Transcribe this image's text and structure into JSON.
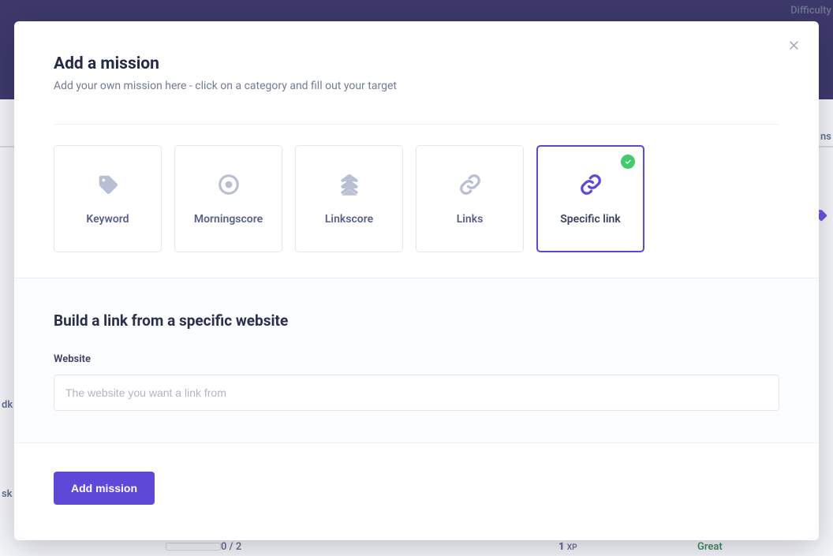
{
  "background": {
    "difficulty_label": "Difficulty",
    "ns_partial": "ns",
    "dk_partial": "dk",
    "sk_partial": "sk",
    "progress": "0 / 2",
    "xp_value": "1",
    "xp_label": "XP",
    "rating": "Great"
  },
  "modal": {
    "title": "Add a mission",
    "subtitle": "Add your own mission here - click on a category and fill out your target",
    "categories": [
      {
        "label": "Keyword",
        "icon": "tag"
      },
      {
        "label": "Morningscore",
        "icon": "target"
      },
      {
        "label": "Linkscore",
        "icon": "chevrons"
      },
      {
        "label": "Links",
        "icon": "link"
      },
      {
        "label": "Specific link",
        "icon": "link",
        "selected": true
      }
    ],
    "form": {
      "title": "Build a link from a specific website",
      "field_label": "Website",
      "placeholder": "The website you want a link from",
      "value": ""
    },
    "submit_label": "Add mission"
  }
}
